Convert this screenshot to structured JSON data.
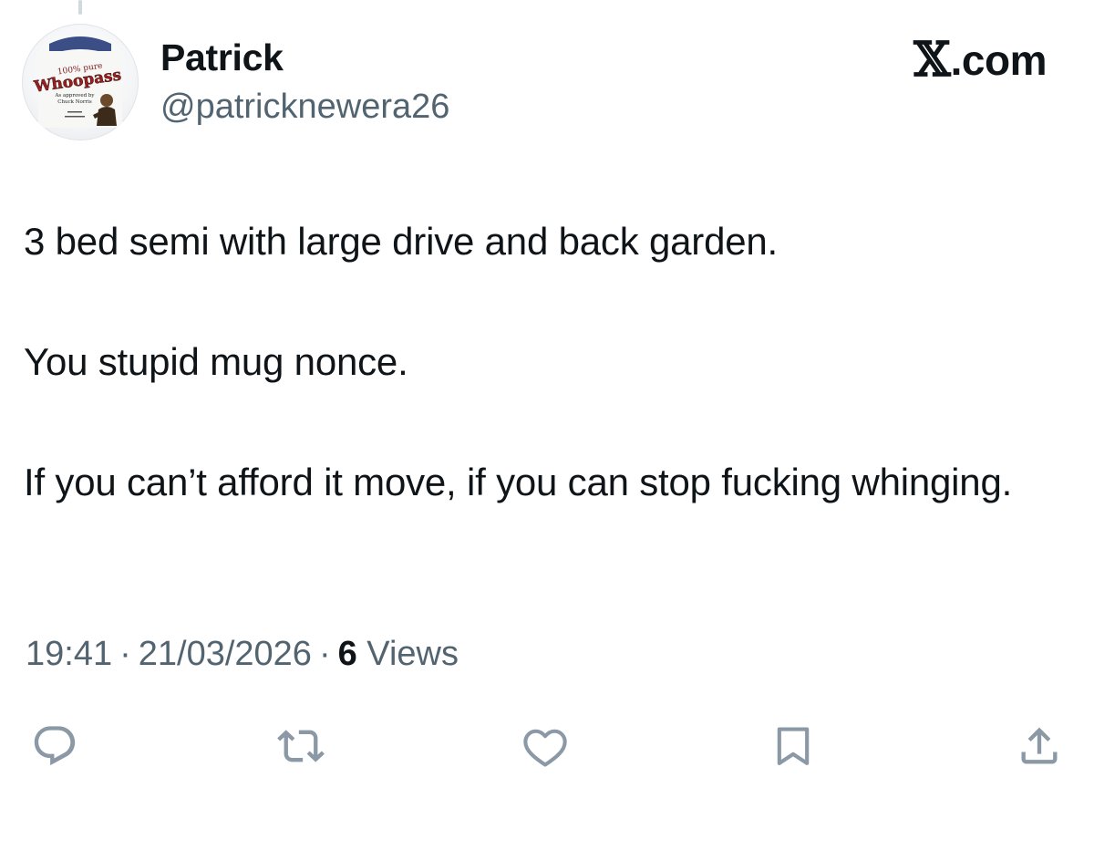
{
  "author": {
    "display_name": "Patrick",
    "handle": "@patricknewera26",
    "avatar": {
      "icon": "whoopass-can-avatar",
      "text_top": "100% pure",
      "text_main": "Whoopass",
      "text_sub": "As approved by",
      "text_sub2": "Chuck Norris"
    }
  },
  "brand": {
    "x_glyph": "𝕏",
    "domain": ".com"
  },
  "tweet": {
    "paragraphs": [
      "3 bed semi with large drive and back garden.",
      "You stupid mug nonce.",
      "If you can’t afford it move, if you can stop fucking whinging."
    ]
  },
  "meta": {
    "time": "19:41",
    "date": "21/03/2026",
    "separator": "·",
    "views_count": "6",
    "views_label": "Views"
  },
  "actions": [
    {
      "name": "reply",
      "icon": "reply-icon"
    },
    {
      "name": "retweet",
      "icon": "retweet-icon"
    },
    {
      "name": "like",
      "icon": "heart-icon"
    },
    {
      "name": "bookmark",
      "icon": "bookmark-icon"
    },
    {
      "name": "share",
      "icon": "share-icon"
    }
  ],
  "colors": {
    "text_primary": "#0f1419",
    "text_secondary": "#536471",
    "icon": "#8b98a5",
    "thread_line": "#cfd9de"
  }
}
